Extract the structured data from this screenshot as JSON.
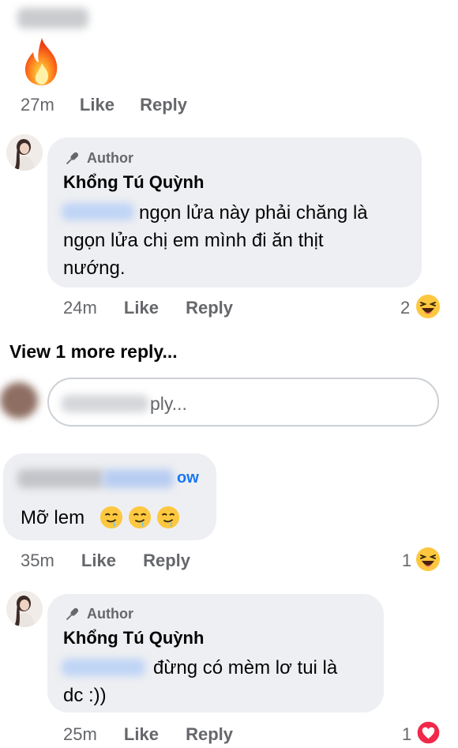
{
  "comment1": {
    "time": "27m",
    "like": "Like",
    "reply": "Reply",
    "icon": "fire-emoji"
  },
  "comment2": {
    "author_tag": "Author",
    "author_name": "Khổng Tú Quỳnh",
    "text_line1": "ngọn lửa này phải chăng là",
    "text_line2": "ngọn lửa chị em mình đi ăn thịt",
    "text_line3": "nướng.",
    "time": "24m",
    "like": "Like",
    "reply": "Reply",
    "reaction_count": "2",
    "reaction_icon": "haha-emoji"
  },
  "view_more": "View 1 more reply...",
  "reply_input": {
    "placeholder_visible": "ply..."
  },
  "comment3": {
    "name_suffix": "ow",
    "text": "Mỡ lem",
    "emojis": "drooling-face x3",
    "time": "35m",
    "like": "Like",
    "reply": "Reply",
    "reaction_count": "1",
    "reaction_icon": "haha-emoji"
  },
  "comment4": {
    "author_tag": "Author",
    "author_name": "Khổng Tú Quỳnh",
    "text_line1": "đừng có mèm lơ tui là",
    "text_line2": "dc :))",
    "time": "25m",
    "like": "Like",
    "reply": "Reply",
    "reaction_count": "1",
    "reaction_icon": "love-emoji"
  },
  "colors": {
    "bubble": "#eeeff2",
    "meta": "#65676b",
    "text": "#050505",
    "link_blue": "#1877f2",
    "border": "#ccd0d5"
  }
}
